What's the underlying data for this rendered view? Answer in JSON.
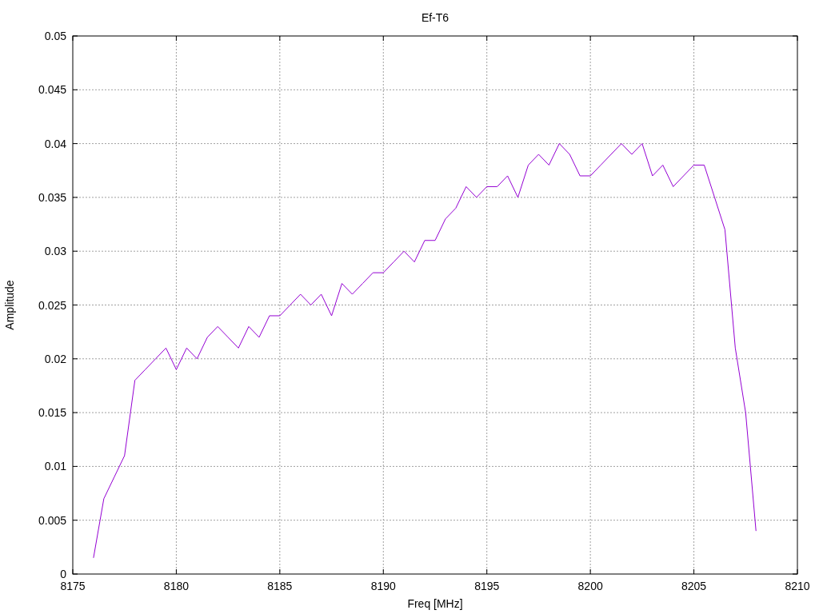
{
  "chart": {
    "chart_data": {
      "type": "line",
      "grid": true,
      "title": "Ef-T6",
      "xlabel": "Freq [MHz]",
      "ylabel": "Amplitude",
      "xlim": [
        8175,
        8210
      ],
      "ylim": [
        0,
        0.05
      ],
      "xticks": [
        8175,
        8180,
        8185,
        8190,
        8195,
        8200,
        8205,
        8210
      ],
      "yticks": [
        {
          "value": 0,
          "label": "0"
        },
        {
          "value": 0.005,
          "label": "0.005"
        },
        {
          "value": 0.01,
          "label": "0.01"
        },
        {
          "value": 0.015,
          "label": "0.015"
        },
        {
          "value": 0.02,
          "label": "0.02"
        },
        {
          "value": 0.025,
          "label": "0.025"
        },
        {
          "value": 0.03,
          "label": "0.03"
        },
        {
          "value": 0.035,
          "label": "0.035"
        },
        {
          "value": 0.04,
          "label": "0.04"
        },
        {
          "value": 0.045,
          "label": "0.045"
        },
        {
          "value": 0.05,
          "label": "0.05"
        }
      ],
      "x": [
        8176,
        8176.5,
        8177,
        8177.5,
        8178,
        8178.5,
        8179,
        8179.5,
        8180,
        8180.5,
        8181,
        8181.5,
        8182,
        8182.5,
        8183,
        8183.5,
        8184,
        8184.5,
        8185,
        8185.5,
        8186,
        8186.5,
        8187,
        8187.5,
        8188,
        8188.5,
        8189,
        8189.5,
        8190,
        8190.5,
        8191,
        8191.5,
        8192,
        8192.5,
        8193,
        8193.5,
        8194,
        8194.5,
        8195,
        8195.5,
        8196,
        8196.5,
        8197,
        8197.5,
        8198,
        8198.5,
        8199,
        8199.5,
        8200,
        8200.5,
        8201,
        8201.5,
        8202,
        8202.5,
        8203,
        8203.5,
        8204,
        8204.5,
        8205,
        8205.5,
        8206,
        8206.5,
        8207,
        8207.5,
        8208
      ],
      "series": [
        {
          "color": "#9400d3",
          "values": [
            0.0015,
            0.007,
            0.009,
            0.011,
            0.018,
            0.019,
            0.02,
            0.021,
            0.019,
            0.021,
            0.02,
            0.022,
            0.023,
            0.022,
            0.021,
            0.023,
            0.022,
            0.024,
            0.024,
            0.025,
            0.026,
            0.025,
            0.026,
            0.024,
            0.027,
            0.026,
            0.027,
            0.028,
            0.028,
            0.029,
            0.03,
            0.029,
            0.031,
            0.031,
            0.033,
            0.034,
            0.036,
            0.035,
            0.036,
            0.036,
            0.037,
            0.035,
            0.038,
            0.039,
            0.038,
            0.04,
            0.039,
            0.037,
            0.037,
            0.038,
            0.039,
            0.04,
            0.039,
            0.04,
            0.037,
            0.038,
            0.036,
            0.037,
            0.038,
            0.038,
            0.035,
            0.032,
            0.021,
            0.015,
            0.004
          ]
        }
      ]
    }
  }
}
